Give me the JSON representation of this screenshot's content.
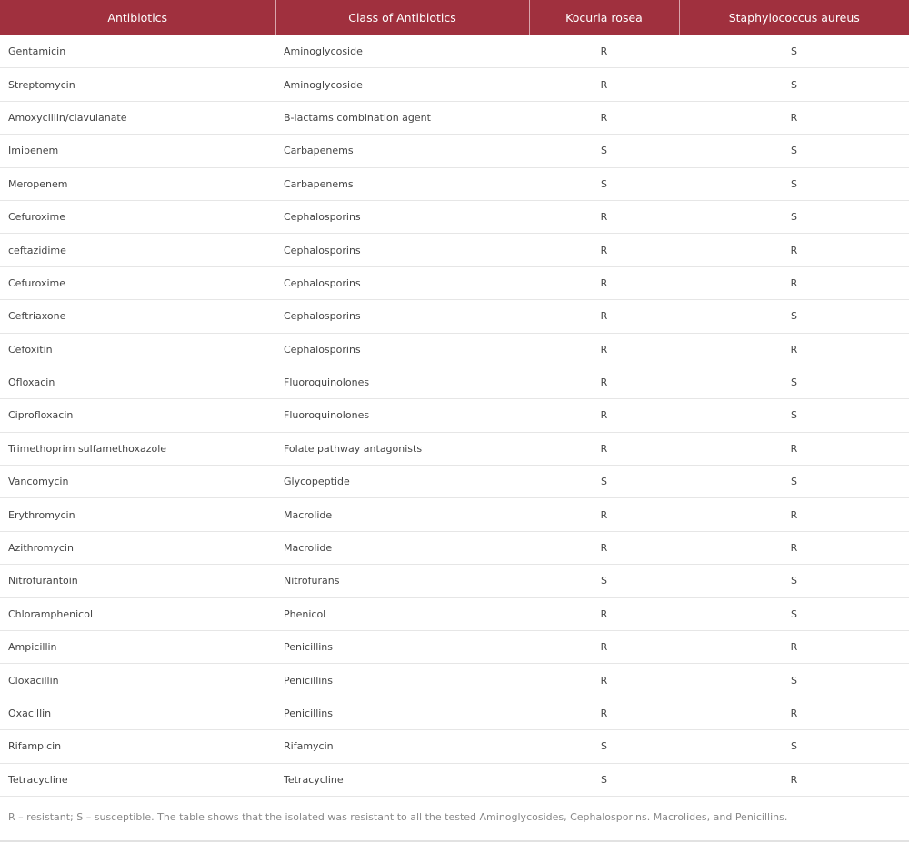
{
  "table": {
    "headers": [
      "Antibiotics",
      "Class of Antibiotics",
      "Kocuria rosea",
      "Staphylococcus aureus"
    ],
    "rows": [
      [
        "Gentamicin",
        "Aminoglycoside",
        "R",
        "S"
      ],
      [
        "Streptomycin",
        "Aminoglycoside",
        "R",
        "S"
      ],
      [
        "Amoxycillin/clavulanate",
        "B-lactams combination agent",
        "R",
        "R"
      ],
      [
        "Imipenem",
        "Carbapenems",
        "S",
        "S"
      ],
      [
        "Meropenem",
        "Carbapenems",
        "S",
        "S"
      ],
      [
        "Cefuroxime",
        "Cephalosporins",
        "R",
        "S"
      ],
      [
        "ceftazidime",
        "Cephalosporins",
        "R",
        "R"
      ],
      [
        "Cefuroxime",
        "Cephalosporins",
        "R",
        "R"
      ],
      [
        "Ceftriaxone",
        "Cephalosporins",
        "R",
        "S"
      ],
      [
        "Cefoxitin",
        "Cephalosporins",
        "R",
        "R"
      ],
      [
        "Ofloxacin",
        "Fluoroquinolones",
        "R",
        "S"
      ],
      [
        "Ciprofloxacin",
        "Fluoroquinolones",
        "R",
        "S"
      ],
      [
        "Trimethoprim sulfamethoxazole",
        "Folate pathway antagonists",
        "R",
        "R"
      ],
      [
        "Vancomycin",
        "Glycopeptide",
        "S",
        "S"
      ],
      [
        "Erythromycin",
        "Macrolide",
        "R",
        "R"
      ],
      [
        "Azithromycin",
        "Macrolide",
        "R",
        "R"
      ],
      [
        "Nitrofurantoin",
        "Nitrofurans",
        "S",
        "S"
      ],
      [
        "Chloramphenicol",
        "Phenicol",
        "R",
        "S"
      ],
      [
        "Ampicillin",
        "Penicillins",
        "R",
        "R"
      ],
      [
        "Cloxacillin",
        "Penicillins",
        "R",
        "S"
      ],
      [
        "Oxacillin",
        "Penicillins",
        "R",
        "R"
      ],
      [
        "Rifampicin",
        "Rifamycin",
        "S",
        "S"
      ],
      [
        "Tetracycline",
        "Tetracycline",
        "S",
        "R"
      ]
    ]
  },
  "footnote": "R – resistant; S – susceptible. The table shows that the isolated was resistant to all the tested Aminoglycosides, Cephalosporins. Macrolides, and Penicillins.",
  "colors": {
    "header_bg": "#a0303e",
    "header_text": "#ffffff",
    "row_border": "#e6e6e6",
    "body_text": "#444444",
    "footnote_text": "#888888"
  }
}
